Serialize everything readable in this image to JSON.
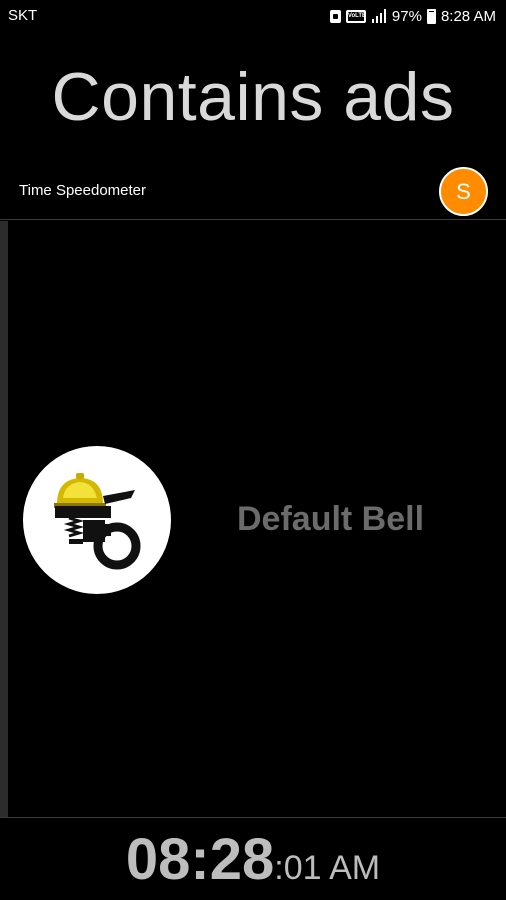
{
  "status_bar": {
    "carrier": "SKT",
    "battery_percent": "97%",
    "time": "8:28 AM",
    "volte_label": "VoLTE",
    "icons": [
      "lock-icon",
      "volte-icon",
      "signal-icon",
      "battery-icon"
    ]
  },
  "ad_banner": {
    "text": "Contains ads"
  },
  "header": {
    "title": "Time Speedometer",
    "avatar_letter": "S",
    "avatar_color": "#ff8c00"
  },
  "bell": {
    "label": "Default Bell",
    "icon": "bell-icon"
  },
  "clock": {
    "hours_minutes": "08:28",
    "seconds": ":01",
    "ampm": " AM"
  },
  "colors": {
    "background": "#000000",
    "accent": "#ff8c00",
    "muted_text": "#6b6b6b",
    "clock_text": "#bdbdbd"
  }
}
